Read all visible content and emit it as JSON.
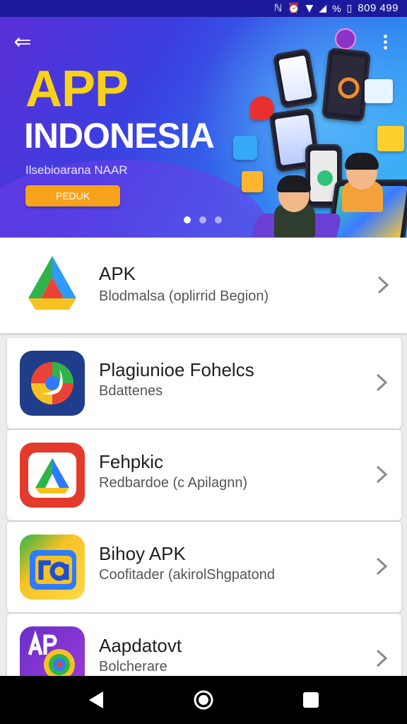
{
  "status_bar": {
    "time": "809 499",
    "battery": "%",
    "icons": [
      "nfc-icon",
      "alarm-icon",
      "wifi-icon",
      "signal-icon",
      "battery-icon"
    ]
  },
  "hero": {
    "title_line1": "APP",
    "title_line2": "INDONESIA",
    "subtitle": "Ilsebioarana NAAR",
    "cta_label": "PEDUK",
    "carousel": {
      "pages": 3,
      "active": 0
    }
  },
  "apps": [
    {
      "name": "APK",
      "subtitle": "Blodmalsa (oplirrid Begion)",
      "icon": "drive-triangle-icon"
    },
    {
      "name": "Plagiunioe Fohelcs",
      "subtitle": "Bdattenes",
      "icon": "chrome-swirl-icon"
    },
    {
      "name": "Fehpkic",
      "subtitle": "Redbardoe (c Apilagnn)",
      "icon": "red-drive-icon"
    },
    {
      "name": "Bihoy APK",
      "subtitle": "Coofitader (akirolShgpatond",
      "icon": "ra-app-icon"
    },
    {
      "name": "Aapdatovt",
      "subtitle": "Bolcherare",
      "icon": "apk-lens-icon"
    }
  ],
  "colors": {
    "status_bar": "#1c1a9c",
    "hero_title_yellow": "#f7d11a",
    "cta_orange": "#f7a21b"
  }
}
